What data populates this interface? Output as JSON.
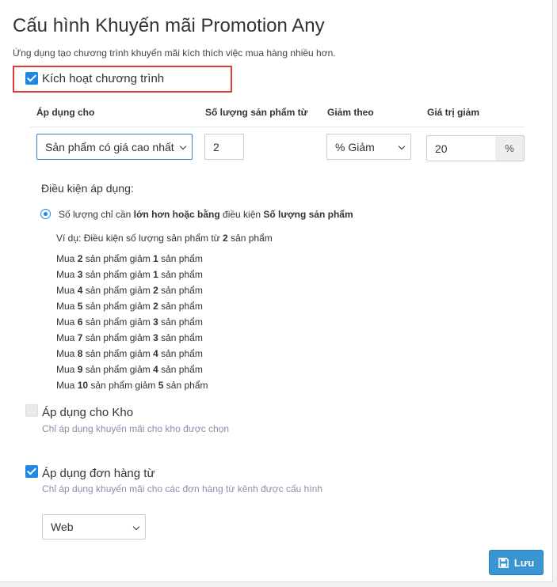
{
  "page": {
    "title": "Cấu hình Khuyến mãi Promotion Any",
    "subtitle": "Ứng dụng tạo chương trình khuyến mãi kích thích việc mua hàng nhiều hơn."
  },
  "activate": {
    "label": "Kích hoạt chương trình",
    "checked": true
  },
  "table": {
    "headers": [
      "Áp dụng cho",
      "Số lượng sản phẩm từ",
      "Giảm theo",
      "Giá trị giảm"
    ],
    "apply_for_value": "Sản phẩm có giá cao nhất",
    "quantity_from_value": "2",
    "discount_by_value": "% Giảm",
    "discount_value": "20",
    "discount_unit": "%"
  },
  "conditions": {
    "title": "Điều kiện áp dụng:",
    "radio": {
      "prefix": "Số lượng chỉ cần ",
      "bold1": "lớn hơn hoặc bằng",
      "middle": " điều kiện ",
      "bold2": "Số lượng sản phẩm"
    },
    "example": {
      "prefix": "Ví dụ: Điều kiện số lượng sản phẩm từ ",
      "bold": "2",
      "suffix": " sản phẩm"
    },
    "rows": [
      {
        "buy": "2",
        "discount": "1"
      },
      {
        "buy": "3",
        "discount": "1"
      },
      {
        "buy": "4",
        "discount": "2"
      },
      {
        "buy": "5",
        "discount": "2"
      },
      {
        "buy": "6",
        "discount": "3"
      },
      {
        "buy": "7",
        "discount": "3"
      },
      {
        "buy": "8",
        "discount": "4"
      },
      {
        "buy": "9",
        "discount": "4"
      },
      {
        "buy": "10",
        "discount": "5"
      }
    ],
    "row_text": {
      "buy": "Mua ",
      "mid": " sản phẩm giảm ",
      "end": " sản phẩm"
    }
  },
  "warehouse": {
    "label": "Áp dụng cho Kho",
    "help": "Chỉ áp dụng khuyến mãi cho kho được chọn",
    "checked": false
  },
  "order_source": {
    "label": "Áp dụng đơn hàng từ",
    "help": "Chỉ áp dụng khuyến mãi cho các đơn hàng từ kênh được cấu hình",
    "checked": true,
    "channel_value": "Web"
  },
  "actions": {
    "save_label": "Lưu",
    "save_icon": "floppy-disk-icon"
  },
  "colors": {
    "accent": "#1e88e5",
    "highlight": "#e53935",
    "button": "#3a95d3"
  }
}
